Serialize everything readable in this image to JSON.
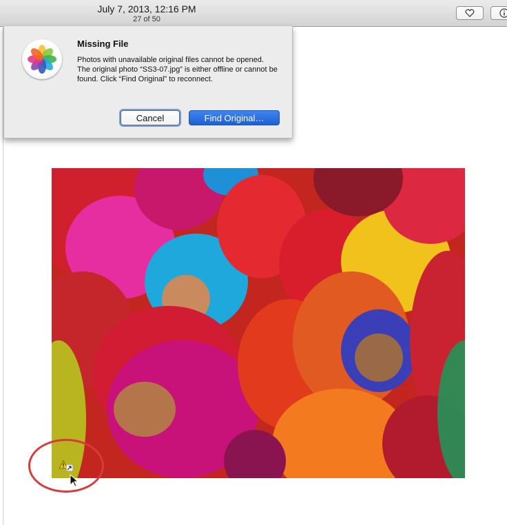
{
  "toolbar": {
    "date": "July 7, 2013, 12:16 PM",
    "counter": "27 of 50"
  },
  "dialog": {
    "title": "Missing File",
    "line1": "Photos with unavailable original files cannot be opened.",
    "line2": "The original photo “SS3-07.jpg” is either offline or cannot be found. Click “Find Original” to reconnect.",
    "cancel_label": "Cancel",
    "find_label": "Find Original…"
  },
  "icons": {
    "app": "photos-app-icon",
    "favorite": "heart-icon",
    "info": "info-icon",
    "warning": "warning-icon",
    "cursor": "mouse-pointer-icon"
  },
  "colors": {
    "accent_blue": "#2a6fde",
    "highlight_ring": "#dc3a3a",
    "warning_yellow": "#f5d000"
  }
}
